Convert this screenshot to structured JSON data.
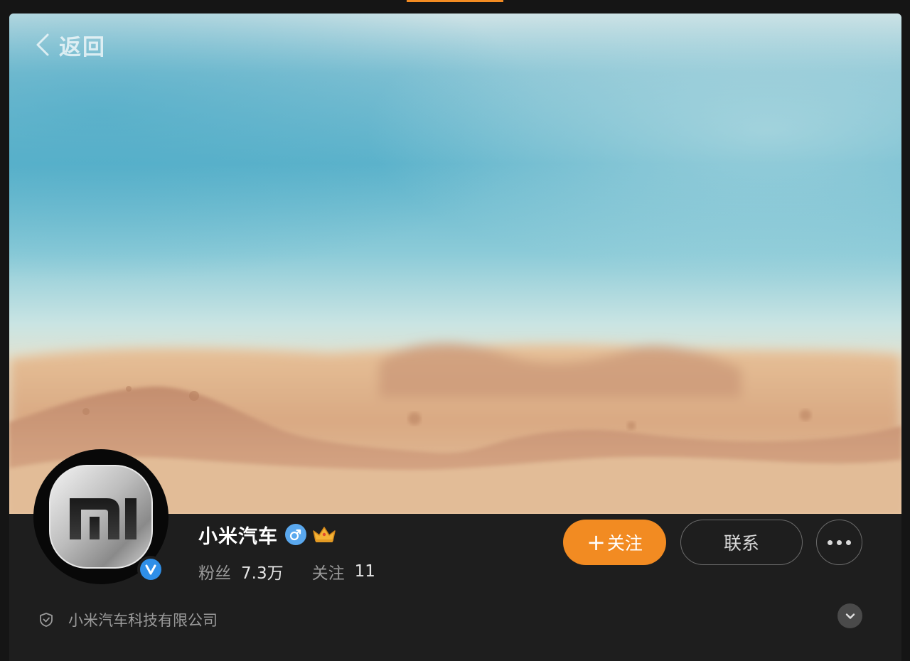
{
  "nav": {
    "back_label": "返回"
  },
  "profile": {
    "name": "小米汽车",
    "avatar_text": "mi",
    "badge_letter": "V",
    "gender_symbol": "♂",
    "fans_label": "粉丝",
    "fans_value": "7.3万",
    "following_label": "关注",
    "following_value": "11",
    "verification": "小米汽车科技有限公司"
  },
  "actions": {
    "follow_plus": "+",
    "follow_label": "关注",
    "contact_label": "联系"
  },
  "icons": {
    "back": "chevron-left-icon",
    "gender": "male-icon",
    "crown": "crown-icon",
    "verified": "verified-badge-icon",
    "more": "more-dots-icon",
    "shield": "shield-icon",
    "expand": "chevron-down-icon"
  },
  "colors": {
    "accent": "#f28b22",
    "verified_blue": "#2f8fe8",
    "gender_blue": "#5aa8ee",
    "background": "#1e1e1e"
  }
}
